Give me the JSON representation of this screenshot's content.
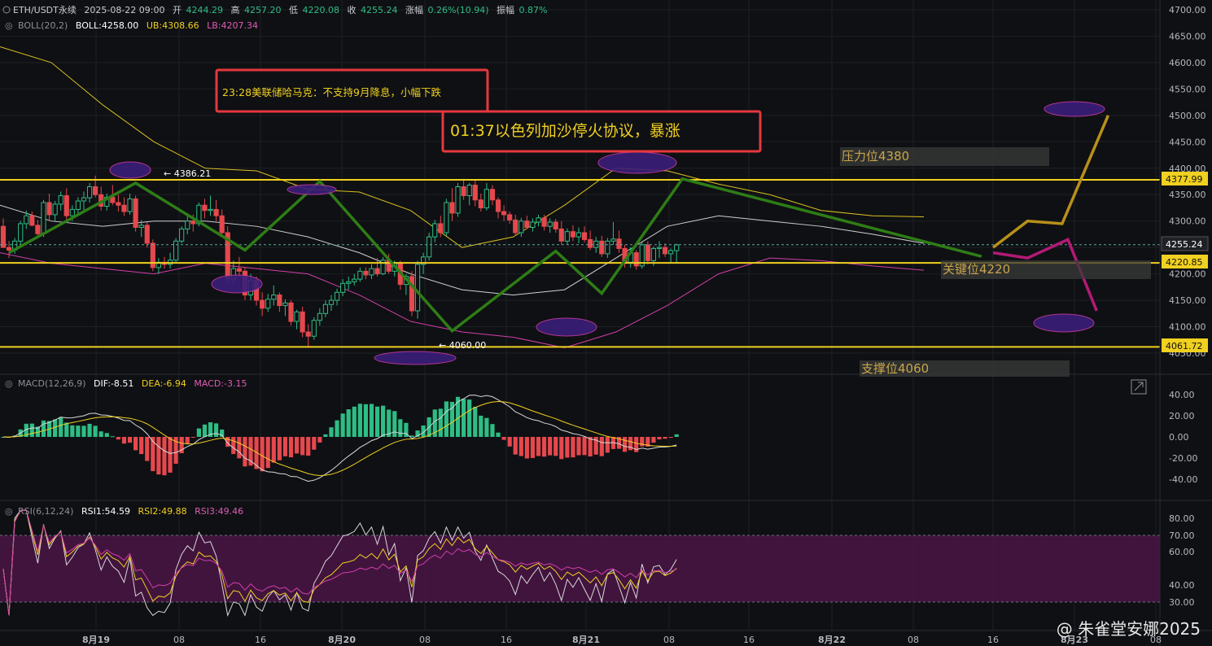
{
  "header": {
    "symbol": "ETH/USDT永续",
    "datetime": "2025-08-22 09:00",
    "open_label": "开",
    "open": "4244.29",
    "high_label": "高",
    "high": "4257.20",
    "low_label": "低",
    "low": "4220.08",
    "close_label": "收",
    "close": "4255.24",
    "change_label": "涨幅",
    "change": "0.26%(10.94)",
    "amp_label": "振幅",
    "amp": "0.87%"
  },
  "boll": {
    "label": "BOLL(20,2)",
    "mid": "BOLL:4258.00",
    "ub": "UB:4308.66",
    "lb": "LB:4207.34"
  },
  "macd": {
    "label": "MACD(12,26,9)",
    "dif": "DIF:-8.51",
    "dea": "DEA:-6.94",
    "macd": "MACD:-3.15"
  },
  "rsi": {
    "label": "RSI(6,12,24)",
    "rsi1": "RSI1:54.59",
    "rsi2": "RSI2:49.88",
    "rsi3": "RSI3:49.46"
  },
  "annotations": {
    "news1": "23:28美联储哈马克：不支持9月降息，小幅下跌",
    "news2": "01:37以色列加沙停火协议，暴涨",
    "resistance_label": "压力位4380",
    "key_label": "关键位4220",
    "support_label": "支撑位4060",
    "high_marker": "← 4386.21",
    "low_marker": "← 4060.00"
  },
  "price_tags": {
    "resistance": "4377.99",
    "current": "4255.24",
    "key": "4220.85",
    "support": "4061.72"
  },
  "watermark": "@ 朱雀堂安娜2025",
  "colors": {
    "up": "#2ebd85",
    "down": "#e5484d",
    "yellow": "#f0d020",
    "magenta": "#c03aa0",
    "trend": "#2e7d16",
    "grid": "#1e2127"
  },
  "chart_data": {
    "type": "candlestick",
    "interval": "1H",
    "price_axis": {
      "ylim": [
        4060,
        4700
      ],
      "ticks": [
        4700,
        4650,
        4600,
        4550,
        4500,
        4450,
        4400,
        4350,
        4300,
        4250,
        4200,
        4150,
        4100,
        4050
      ]
    },
    "macd_axis": {
      "ticks": [
        "40.00",
        "20.00",
        "0.00",
        "-20.00",
        "-40.00"
      ],
      "ylim": [
        -55,
        50
      ]
    },
    "rsi_axis": {
      "ticks": [
        "80.00",
        "70.00",
        "60.00",
        "40.00",
        "30.00"
      ],
      "ylim": [
        22,
        85
      ]
    },
    "time_ticks": [
      "8月19",
      "08",
      "16",
      "8月20",
      "08",
      "16",
      "8月21",
      "08",
      "16",
      "8月22",
      "08",
      "16",
      "8月23",
      "08"
    ],
    "candles_hourly": [
      [
        4290,
        4305,
        4270,
        4250
      ],
      [
        4250,
        4262,
        4230,
        4245
      ],
      [
        4245,
        4268,
        4238,
        4262
      ],
      [
        4262,
        4300,
        4255,
        4295
      ],
      [
        4295,
        4320,
        4285,
        4310
      ],
      [
        4310,
        4318,
        4290,
        4292
      ],
      [
        4292,
        4302,
        4270,
        4276
      ],
      [
        4276,
        4340,
        4270,
        4335
      ],
      [
        4335,
        4352,
        4300,
        4312
      ],
      [
        4312,
        4338,
        4300,
        4332
      ],
      [
        4332,
        4356,
        4320,
        4348
      ],
      [
        4348,
        4362,
        4300,
        4310
      ],
      [
        4310,
        4330,
        4300,
        4322
      ],
      [
        4322,
        4345,
        4310,
        4338
      ],
      [
        4338,
        4356,
        4320,
        4344
      ],
      [
        4344,
        4372,
        4335,
        4365
      ],
      [
        4365,
        4386,
        4345,
        4350
      ],
      [
        4350,
        4365,
        4320,
        4328
      ],
      [
        4328,
        4352,
        4320,
        4345
      ],
      [
        4345,
        4368,
        4330,
        4335
      ],
      [
        4335,
        4350,
        4318,
        4330
      ],
      [
        4330,
        4345,
        4310,
        4318
      ],
      [
        4318,
        4352,
        4312,
        4342
      ],
      [
        4342,
        4348,
        4280,
        4288
      ],
      [
        4288,
        4302,
        4270,
        4292
      ],
      [
        4292,
        4298,
        4250,
        4258
      ],
      [
        4258,
        4265,
        4205,
        4212
      ],
      [
        4212,
        4230,
        4200,
        4222
      ],
      [
        4222,
        4232,
        4210,
        4218
      ],
      [
        4218,
        4240,
        4210,
        4226
      ],
      [
        4226,
        4268,
        4220,
        4262
      ],
      [
        4262,
        4290,
        4258,
        4285
      ],
      [
        4285,
        4310,
        4275,
        4300
      ],
      [
        4300,
        4312,
        4280,
        4295
      ],
      [
        4295,
        4335,
        4290,
        4330
      ],
      [
        4330,
        4342,
        4305,
        4320
      ],
      [
        4320,
        4348,
        4310,
        4322
      ],
      [
        4322,
        4340,
        4300,
        4310
      ],
      [
        4310,
        4322,
        4270,
        4278
      ],
      [
        4278,
        4290,
        4180,
        4190
      ],
      [
        4190,
        4225,
        4180,
        4210
      ],
      [
        4210,
        4232,
        4195,
        4205
      ],
      [
        4205,
        4212,
        4150,
        4160
      ],
      [
        4160,
        4200,
        4150,
        4188
      ],
      [
        4188,
        4195,
        4140,
        4150
      ],
      [
        4150,
        4165,
        4120,
        4135
      ],
      [
        4135,
        4162,
        4128,
        4152
      ],
      [
        4152,
        4178,
        4140,
        4160
      ],
      [
        4160,
        4165,
        4128,
        4140
      ],
      [
        4140,
        4152,
        4120,
        4145
      ],
      [
        4145,
        4150,
        4102,
        4110
      ],
      [
        4110,
        4132,
        4095,
        4128
      ],
      [
        4128,
        4138,
        4080,
        4090
      ],
      [
        4090,
        4105,
        4060,
        4082
      ],
      [
        4082,
        4118,
        4075,
        4112
      ],
      [
        4112,
        4135,
        4102,
        4125
      ],
      [
        4125,
        4150,
        4118,
        4142
      ],
      [
        4142,
        4160,
        4130,
        4150
      ],
      [
        4150,
        4172,
        4140,
        4165
      ],
      [
        4165,
        4190,
        4158,
        4182
      ],
      [
        4182,
        4195,
        4170,
        4185
      ],
      [
        4185,
        4200,
        4178,
        4190
      ],
      [
        4190,
        4212,
        4185,
        4205
      ],
      [
        4205,
        4212,
        4190,
        4198
      ],
      [
        4198,
        4218,
        4190,
        4210
      ],
      [
        4210,
        4230,
        4195,
        4200
      ],
      [
        4200,
        4232,
        4198,
        4226
      ],
      [
        4226,
        4238,
        4200,
        4205
      ],
      [
        4205,
        4225,
        4195,
        4220
      ],
      [
        4220,
        4225,
        4170,
        4180
      ],
      [
        4180,
        4200,
        4160,
        4195
      ],
      [
        4195,
        4205,
        4120,
        4130
      ],
      [
        4130,
        4225,
        4115,
        4218
      ],
      [
        4218,
        4240,
        4200,
        4232
      ],
      [
        4232,
        4278,
        4225,
        4270
      ],
      [
        4270,
        4302,
        4260,
        4295
      ],
      [
        4295,
        4310,
        4270,
        4278
      ],
      [
        4278,
        4342,
        4272,
        4335
      ],
      [
        4335,
        4362,
        4300,
        4315
      ],
      [
        4315,
        4372,
        4308,
        4365
      ],
      [
        4365,
        4380,
        4340,
        4348
      ],
      [
        4348,
        4372,
        4330,
        4368
      ],
      [
        4368,
        4378,
        4328,
        4340
      ],
      [
        4340,
        4352,
        4318,
        4325
      ],
      [
        4325,
        4372,
        4320,
        4360
      ],
      [
        4360,
        4368,
        4330,
        4340
      ],
      [
        4340,
        4345,
        4305,
        4318
      ],
      [
        4318,
        4330,
        4300,
        4312
      ],
      [
        4312,
        4318,
        4295,
        4302
      ],
      [
        4302,
        4312,
        4272,
        4278
      ],
      [
        4278,
        4306,
        4270,
        4300
      ],
      [
        4300,
        4310,
        4285,
        4288
      ],
      [
        4288,
        4305,
        4280,
        4298
      ],
      [
        4298,
        4312,
        4290,
        4306
      ],
      [
        4306,
        4312,
        4282,
        4290
      ],
      [
        4290,
        4305,
        4278,
        4298
      ],
      [
        4298,
        4304,
        4278,
        4285
      ],
      [
        4285,
        4300,
        4255,
        4262
      ],
      [
        4262,
        4286,
        4255,
        4280
      ],
      [
        4280,
        4292,
        4262,
        4270
      ],
      [
        4270,
        4288,
        4258,
        4278
      ],
      [
        4278,
        4290,
        4260,
        4265
      ],
      [
        4265,
        4282,
        4245,
        4250
      ],
      [
        4250,
        4270,
        4240,
        4262
      ],
      [
        4262,
        4272,
        4232,
        4238
      ],
      [
        4238,
        4268,
        4230,
        4262
      ],
      [
        4262,
        4298,
        4255,
        4266
      ],
      [
        4266,
        4282,
        4240,
        4248
      ],
      [
        4248,
        4255,
        4212,
        4222
      ],
      [
        4222,
        4250,
        4212,
        4240
      ],
      [
        4240,
        4245,
        4208,
        4215
      ],
      [
        4215,
        4260,
        4210,
        4255
      ],
      [
        4255,
        4262,
        4218,
        4225
      ],
      [
        4225,
        4252,
        4215,
        4248
      ],
      [
        4248,
        4262,
        4230,
        4250
      ],
      [
        4250,
        4258,
        4232,
        4238
      ],
      [
        4238,
        4248,
        4220,
        4244
      ],
      [
        4244,
        4257,
        4220,
        4255
      ]
    ],
    "boll_bands": {
      "upper": [
        4630,
        4600,
        4520,
        4450,
        4400,
        4395,
        4360,
        4355,
        4320,
        4250,
        4270,
        4330,
        4400,
        4395,
        4370,
        4350,
        4320,
        4310,
        4308
      ],
      "middle": [
        4330,
        4300,
        4290,
        4300,
        4300,
        4290,
        4270,
        4240,
        4200,
        4170,
        4160,
        4170,
        4230,
        4290,
        4310,
        4300,
        4290,
        4275,
        4258
      ],
      "lower": [
        4240,
        4220,
        4210,
        4200,
        4220,
        4210,
        4200,
        4160,
        4110,
        4090,
        4080,
        4060,
        4090,
        4140,
        4200,
        4230,
        4225,
        4215,
        4207
      ]
    },
    "trend_path": [
      [
        1,
        4240
      ],
      [
        23,
        4372
      ],
      [
        42,
        4245
      ],
      [
        55,
        4375
      ],
      [
        78,
        4092
      ],
      [
        96,
        4243
      ],
      [
        104,
        4163
      ],
      [
        118,
        4380
      ],
      [
        170,
        4233
      ]
    ],
    "projection_yellow": [
      [
        172,
        4250
      ],
      [
        178,
        4300
      ],
      [
        184,
        4295
      ],
      [
        192,
        4500
      ]
    ],
    "projection_magenta": [
      [
        172,
        4240
      ],
      [
        178,
        4230
      ],
      [
        185,
        4265
      ],
      [
        190,
        4130
      ]
    ],
    "levels": [
      4377.99,
      4220.85,
      4061.72,
      4255.24
    ]
  }
}
